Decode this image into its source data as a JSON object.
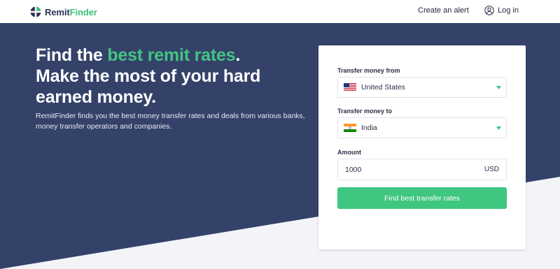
{
  "brand": {
    "name_part1": "Remit",
    "name_part2": "Finder"
  },
  "nav": {
    "create_alert": "Create an alert",
    "login": "Log in"
  },
  "hero": {
    "headline_part1": "Find the ",
    "headline_highlight": "best remit rates",
    "headline_part2": ".",
    "headline_line2": "Make the most of your hard earned money.",
    "subtext": "RemitFinder finds you the best money transfer rates and deals from various banks, money transfer operators and companies."
  },
  "form": {
    "from_label": "Transfer money from",
    "from_value": "United States",
    "to_label": "Transfer money to",
    "to_value": "India",
    "amount_label": "Amount",
    "amount_value": "1000",
    "currency": "USD",
    "submit_label": "Find best transfer rates"
  },
  "colors": {
    "hero_bg": "#34426a",
    "accent_green": "#3fc680",
    "brand_dark": "#2c3357"
  },
  "icons": {
    "logo": "globe-logo-icon",
    "login": "user-circle-icon",
    "from_flag": "us-flag-icon",
    "to_flag": "india-flag-icon",
    "dropdown": "chevron-down-icon"
  }
}
